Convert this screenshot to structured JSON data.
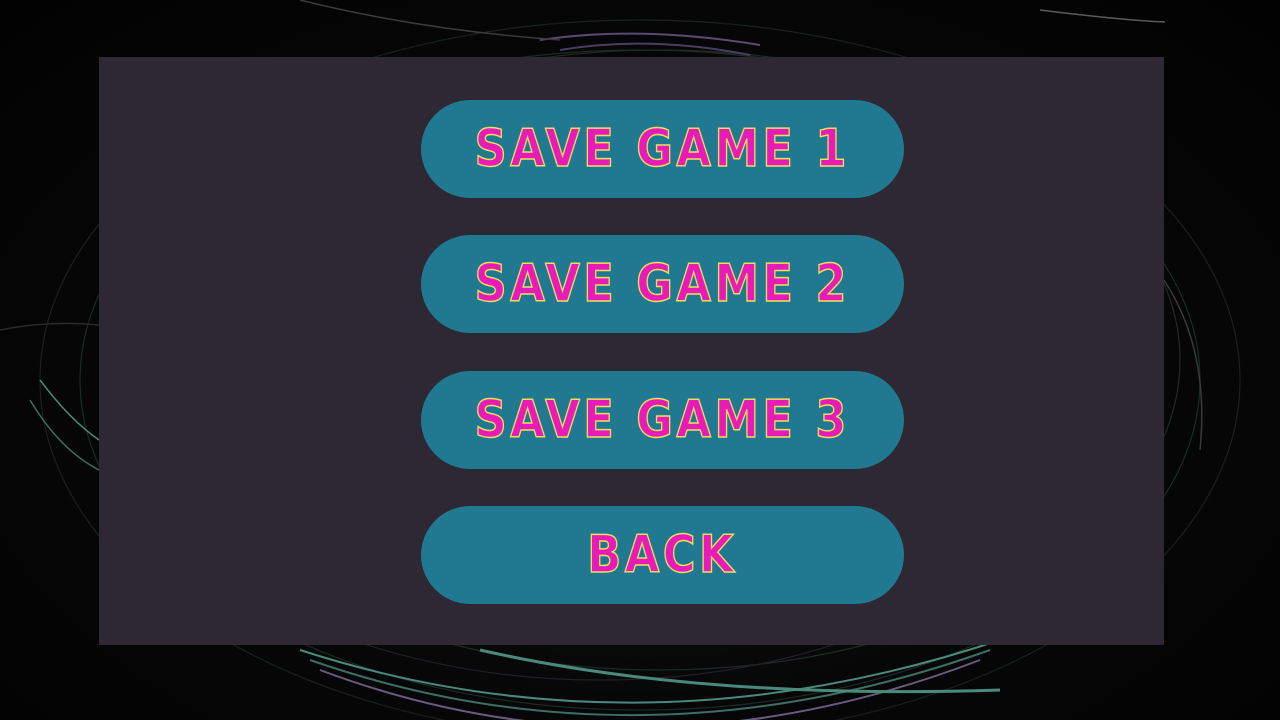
{
  "menu": {
    "buttons": [
      {
        "label": "SAVE GAME 1"
      },
      {
        "label": "SAVE GAME 2"
      },
      {
        "label": "SAVE GAME 3"
      },
      {
        "label": "BACK"
      }
    ]
  },
  "colors": {
    "background": "#050505",
    "panel": "#2d2833",
    "button": "#207990",
    "label_fill": "#e81ab8",
    "label_outline": "#e8e05a",
    "swirl_teal": "#4a8a7a",
    "swirl_purple": "#6a5a80"
  }
}
